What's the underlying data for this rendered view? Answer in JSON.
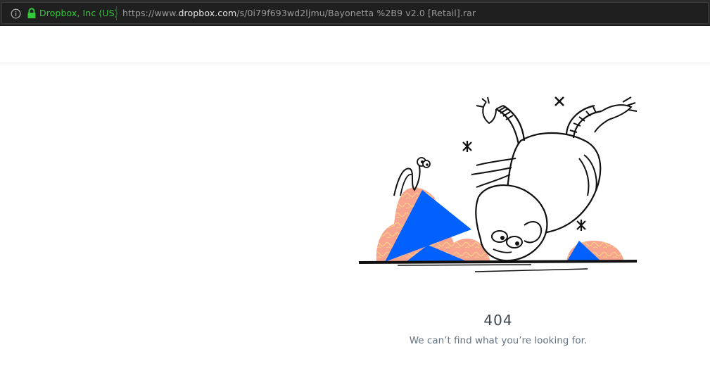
{
  "browser": {
    "site_identity": "Dropbox, Inc (US)",
    "url_prefix": "https://www.",
    "url_domain": "dropbox.com",
    "url_path": "/s/0i79f693wd2ljmu/Bayonetta %2B9 v2.0 [Retail].rar",
    "identity_color": "#34c73c"
  },
  "error": {
    "code": "404",
    "message": "We can’t find what you’re looking for."
  },
  "illustration": {
    "icon": "upside-down-character-illustration",
    "accent_blue": "#0061fe",
    "accent_pink": "#f7a48e"
  }
}
